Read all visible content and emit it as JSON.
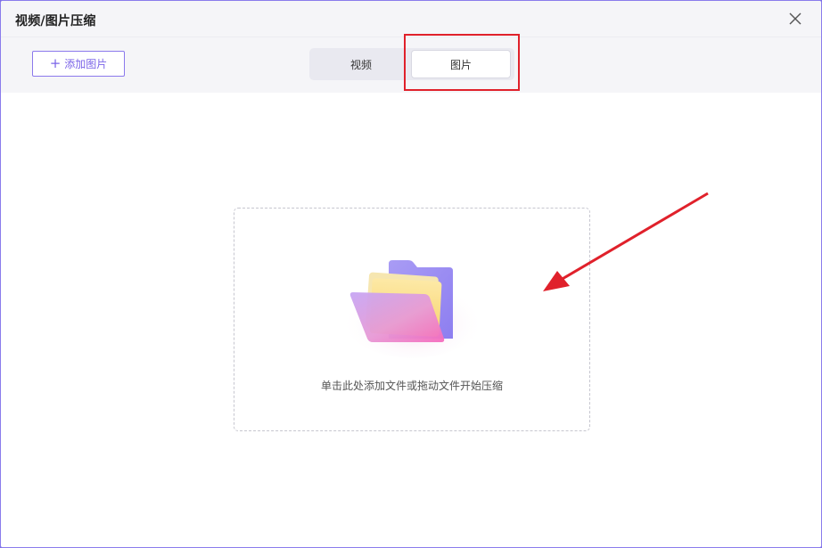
{
  "window": {
    "title": "视频/图片压缩"
  },
  "toolbar": {
    "add_button_label": "添加图片",
    "add_button_icon": "plus-icon"
  },
  "tabs": [
    {
      "label": "视频",
      "active": false
    },
    {
      "label": "图片",
      "active": true
    }
  ],
  "dropzone": {
    "hint": "单击此处添加文件或拖动文件开始压缩",
    "icon": "folder-icon"
  },
  "colors": {
    "accent": "#7b64e8",
    "highlight": "#e0212b"
  }
}
